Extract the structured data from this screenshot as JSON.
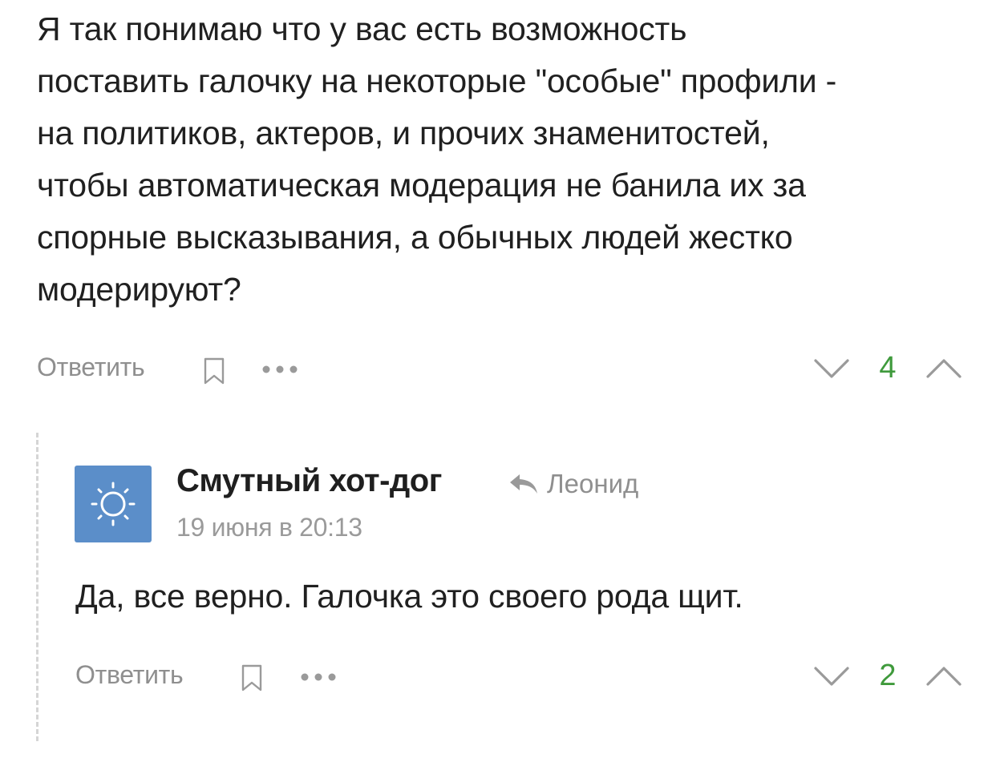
{
  "comment": {
    "lines": [
      "Я так понимаю что у вас есть возможность",
      "поставить галочку на некоторые \"особые\" профили -",
      "на политиков, актеров, и прочих знаменитостей,",
      "чтобы автоматическая модерация не банила их за",
      "спорные высказывания, а обычных людей жестко",
      "модерируют?"
    ],
    "actions": {
      "reply_label": "Ответить",
      "rating": "4"
    }
  },
  "reply": {
    "author": "Смутный хот-дог",
    "reply_to": "Леонид",
    "date": "19 июня в 20:13",
    "text": "Да, все верно. Галочка это своего рода щит.",
    "actions": {
      "reply_label": "Ответить",
      "rating": "2"
    }
  },
  "colors": {
    "rating_positive": "#3f9a3c",
    "avatar_bg": "#5b8ec9",
    "muted_text": "#8f8f8f"
  },
  "icons": {
    "bookmark": "bookmark-icon",
    "more": "more-dots-icon",
    "vote_down": "chevron-down-icon",
    "vote_up": "chevron-up-icon",
    "reply_arrow": "reply-arrow-icon",
    "avatar": "sun-icon"
  }
}
